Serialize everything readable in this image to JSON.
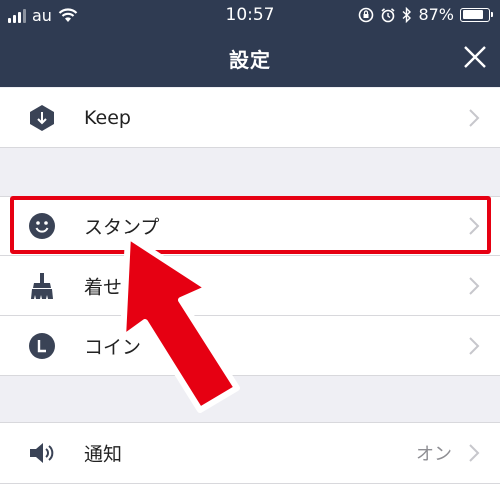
{
  "status_bar": {
    "carrier": "au",
    "time": "10:57",
    "battery": "87%",
    "battery_level": 0.87
  },
  "header": {
    "title": "設定"
  },
  "rows": [
    {
      "label": "Keep",
      "icon": "keep-hexagon-icon"
    },
    {
      "label": "スタンプ",
      "icon": "smiley-icon"
    },
    {
      "label": "着せ",
      "icon": "brush-icon"
    },
    {
      "label": "コイン",
      "icon": "coin-icon"
    },
    {
      "label": "通知",
      "value": "オン",
      "icon": "speaker-icon"
    }
  ],
  "colors": {
    "header_bg": "#2f3b52",
    "highlight": "#e60012",
    "icon": "#3a4356"
  }
}
